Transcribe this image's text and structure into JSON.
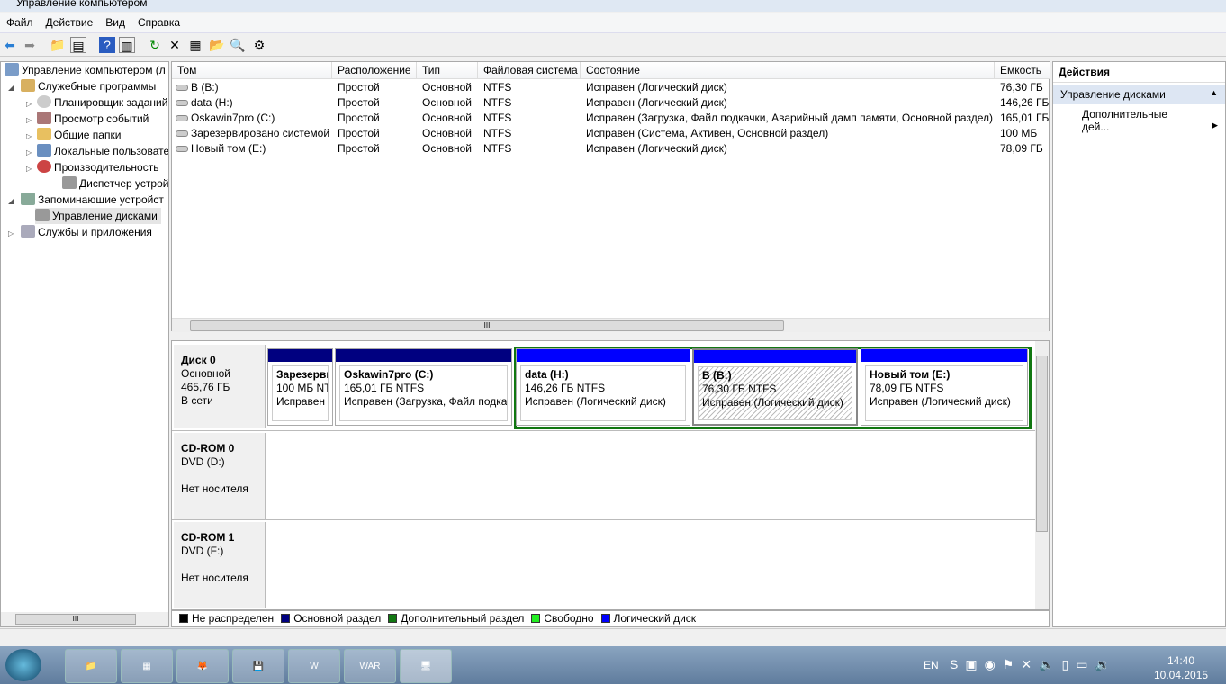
{
  "window": {
    "title": "Управление компьютером"
  },
  "menu": [
    "Файл",
    "Действие",
    "Вид",
    "Справка"
  ],
  "toolbar": [
    "back-icon",
    "forward-icon",
    "up-icon",
    "show-hide-tree-icon",
    "help-icon",
    "show-hide-action-icon",
    "refresh-icon",
    "delete-icon",
    "properties-icon",
    "open-icon",
    "search-icon",
    "settings-icon"
  ],
  "tree": [
    {
      "label": "Управление компьютером (л",
      "level": 0
    },
    {
      "label": "Служебные программы",
      "level": 1,
      "expanded": true
    },
    {
      "label": "Планировщик заданий",
      "level": 2
    },
    {
      "label": "Просмотр событий",
      "level": 2
    },
    {
      "label": "Общие папки",
      "level": 2
    },
    {
      "label": "Локальные пользовате",
      "level": 2
    },
    {
      "label": "Производительность",
      "level": 2
    },
    {
      "label": "Диспетчер устройств",
      "level": 2
    },
    {
      "label": "Запоминающие устройст",
      "level": 1,
      "expanded": true
    },
    {
      "label": "Управление дисками",
      "level": 2,
      "selected": true
    },
    {
      "label": "Службы и приложения",
      "level": 1
    }
  ],
  "volumes": {
    "columns": [
      "Том",
      "Расположение",
      "Тип",
      "Файловая система",
      "Состояние",
      "Емкость"
    ],
    "rows": [
      [
        "B (B:)",
        "Простой",
        "Основной",
        "NTFS",
        "Исправен (Логический диск)",
        "76,30 ГБ"
      ],
      [
        "data (H:)",
        "Простой",
        "Основной",
        "NTFS",
        "Исправен (Логический диск)",
        "146,26 ГБ"
      ],
      [
        "Oskawin7pro (C:)",
        "Простой",
        "Основной",
        "NTFS",
        "Исправен (Загрузка, Файл подкачки, Аварийный дамп памяти, Основной раздел)",
        "165,01 ГБ"
      ],
      [
        "Зарезервировано системой",
        "Простой",
        "Основной",
        "NTFS",
        "Исправен (Система, Активен, Основной раздел)",
        "100 МБ"
      ],
      [
        "Новый том (E:)",
        "Простой",
        "Основной",
        "NTFS",
        "Исправен (Логический диск)",
        "78,09 ГБ"
      ]
    ]
  },
  "disks": [
    {
      "name": "Диск 0",
      "type": "Основной",
      "size": "465,76 ГБ",
      "status": "В сети",
      "partitions": [
        {
          "name": "Зарезерви",
          "size": "100 МБ NTI",
          "state": "Исправен (",
          "kind": "primary"
        },
        {
          "name": "Oskawin7pro  (C:)",
          "size": "165,01 ГБ NTFS",
          "state": "Исправен (Загрузка, Файл подкач",
          "kind": "primary"
        },
        {
          "name": "data  (H:)",
          "size": "146,26 ГБ NTFS",
          "state": "Исправен (Логический диск)",
          "kind": "logical"
        },
        {
          "name": "B  (B:)",
          "size": "76,30 ГБ NTFS",
          "state": "Исправен (Логический диск)",
          "kind": "logical",
          "selected": true
        },
        {
          "name": "Новый том  (E:)",
          "size": "78,09 ГБ NTFS",
          "state": "Исправен (Логический диск)",
          "kind": "logical"
        }
      ]
    },
    {
      "name": "CD-ROM 0",
      "type": "DVD (D:)",
      "status": "Нет носителя"
    },
    {
      "name": "CD-ROM 1",
      "type": "DVD (F:)",
      "status": "Нет носителя"
    }
  ],
  "legend": [
    {
      "label": "Не распределен",
      "color": "#000000"
    },
    {
      "label": "Основной раздел",
      "color": "#000080"
    },
    {
      "label": "Дополнительный раздел",
      "color": "#117711"
    },
    {
      "label": "Свободно",
      "color": "#22ee22"
    },
    {
      "label": "Логический диск",
      "color": "#0000ff"
    }
  ],
  "actions": {
    "title": "Действия",
    "section": "Управление дисками",
    "item": "Дополнительные дей..."
  },
  "taskbar": {
    "apps": [
      "explorer",
      "calculator",
      "firefox",
      "floppy-app",
      "word",
      "this-war-of-mine",
      "computer-management"
    ],
    "lang": "EN",
    "time": "14:40",
    "date": "10.04.2015"
  }
}
